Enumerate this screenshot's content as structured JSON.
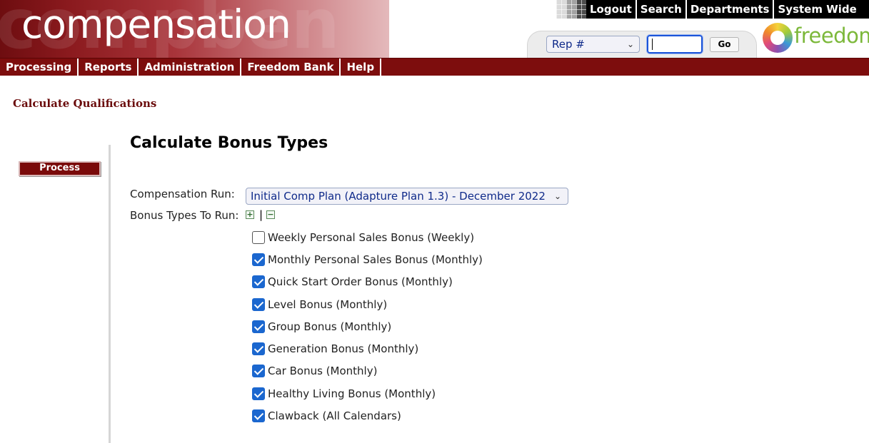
{
  "header": {
    "brand": "compensation",
    "top_links": [
      "Logout",
      "Search",
      "Departments",
      "System Wide Help"
    ],
    "rep_select": {
      "selected": "Rep #"
    },
    "rep_input": {
      "value": ""
    },
    "go_label": "Go",
    "partner_logo": "freedom"
  },
  "nav": {
    "items": [
      "Processing",
      "Reports",
      "Administration",
      "Freedom Bank",
      "Help"
    ]
  },
  "page": {
    "heading": "Calculate Qualifications",
    "process_label": "Process",
    "section_title": "Calculate Bonus Types",
    "comp_run_label": "Compensation Run:",
    "comp_run_selected": "Initial Comp Plan (Adapture Plan 1.3) - December 2022",
    "bonus_types_label": "Bonus Types To Run:",
    "expand_symbol": "+",
    "separator": "|",
    "collapse_symbol": "−",
    "bonus_types": [
      {
        "label": "Weekly Personal Sales Bonus (Weekly)",
        "checked": false
      },
      {
        "label": "Monthly Personal Sales Bonus (Monthly)",
        "checked": true
      },
      {
        "label": "Quick Start Order Bonus (Monthly)",
        "checked": true
      },
      {
        "label": "Level Bonus (Monthly)",
        "checked": true
      },
      {
        "label": "Group Bonus (Monthly)",
        "checked": true
      },
      {
        "label": "Generation Bonus (Monthly)",
        "checked": true
      },
      {
        "label": "Car Bonus (Monthly)",
        "checked": true
      },
      {
        "label": "Healthy Living Bonus (Monthly)",
        "checked": true
      },
      {
        "label": "Clawback (All Calendars)",
        "checked": true
      }
    ]
  },
  "colors": {
    "brand_maroon": "#7d0d0d",
    "heading_maroon": "#6a0b0b",
    "checkbox_blue": "#1b67cf",
    "logo_green": "#7cb83a"
  }
}
